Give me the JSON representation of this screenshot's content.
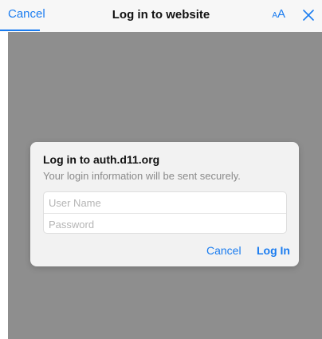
{
  "nav": {
    "cancel_label": "Cancel",
    "title": "Log in to website",
    "text_size_small": "A",
    "text_size_large": "A",
    "close_icon": "close-x-icon"
  },
  "dialog": {
    "title": "Log in to auth.d11.org",
    "subtitle": "Your login information will be sent securely.",
    "username_placeholder": "User Name",
    "username_value": "",
    "password_placeholder": "Password",
    "password_value": "",
    "cancel_label": "Cancel",
    "login_label": "Log In"
  },
  "colors": {
    "accent": "#1a7cf0",
    "overlay": "#8e8e8e",
    "dialog_background": "#f2f2f2",
    "nav_background": "#f7f7f7"
  }
}
